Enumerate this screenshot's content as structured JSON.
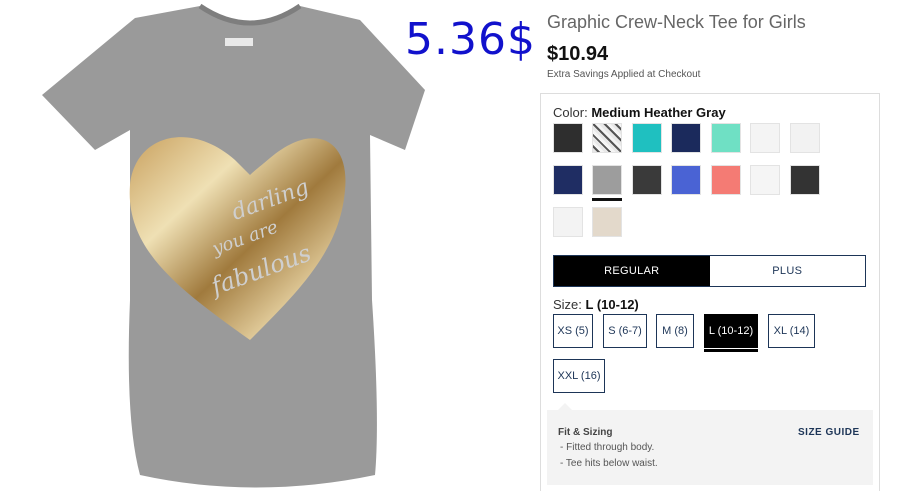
{
  "overlay": {
    "price_text": "5.36$"
  },
  "product": {
    "title": "Graphic Crew-Neck Tee for Girls",
    "price": "$10.94",
    "savings_note": "Extra Savings Applied at Checkout"
  },
  "color": {
    "label": "Color:",
    "selected": "Medium Heather Gray",
    "swatches": [
      {
        "name": "charcoal",
        "hex": "#2e2e2e"
      },
      {
        "name": "tiger-print",
        "hex": "#cfcfcf"
      },
      {
        "name": "turquoise",
        "hex": "#1fc0c0"
      },
      {
        "name": "navy",
        "hex": "#1b2a5c"
      },
      {
        "name": "mint",
        "hex": "#6fe0c4"
      },
      {
        "name": "white-1",
        "hex": "#f4f4f4"
      },
      {
        "name": "white-2",
        "hex": "#f2f2f2"
      },
      {
        "name": "dark-navy",
        "hex": "#1f2d63"
      },
      {
        "name": "medium-heather-gray",
        "hex": "#9d9d9d"
      },
      {
        "name": "dark-gray",
        "hex": "#3a3a3a"
      },
      {
        "name": "periwinkle",
        "hex": "#4a63d4"
      },
      {
        "name": "coral",
        "hex": "#f47b74"
      },
      {
        "name": "white-3",
        "hex": "#f5f5f5"
      },
      {
        "name": "black-heather",
        "hex": "#333333"
      },
      {
        "name": "white-4",
        "hex": "#f3f3f3"
      },
      {
        "name": "oatmeal",
        "hex": "#e3d9cb"
      }
    ]
  },
  "fit": {
    "regular": "REGULAR",
    "plus": "PLUS"
  },
  "size": {
    "label": "Size:",
    "selected": "L (10-12)",
    "options": [
      "XS (5)",
      "S (6-7)",
      "M (8)",
      "L (10-12)",
      "XL (14)",
      "XXL (16)"
    ]
  },
  "fit_sizing": {
    "title": "Fit & Sizing",
    "lines": [
      "- Fitted through body.",
      "- Tee hits below waist."
    ],
    "size_guide": "SIZE GUIDE"
  }
}
